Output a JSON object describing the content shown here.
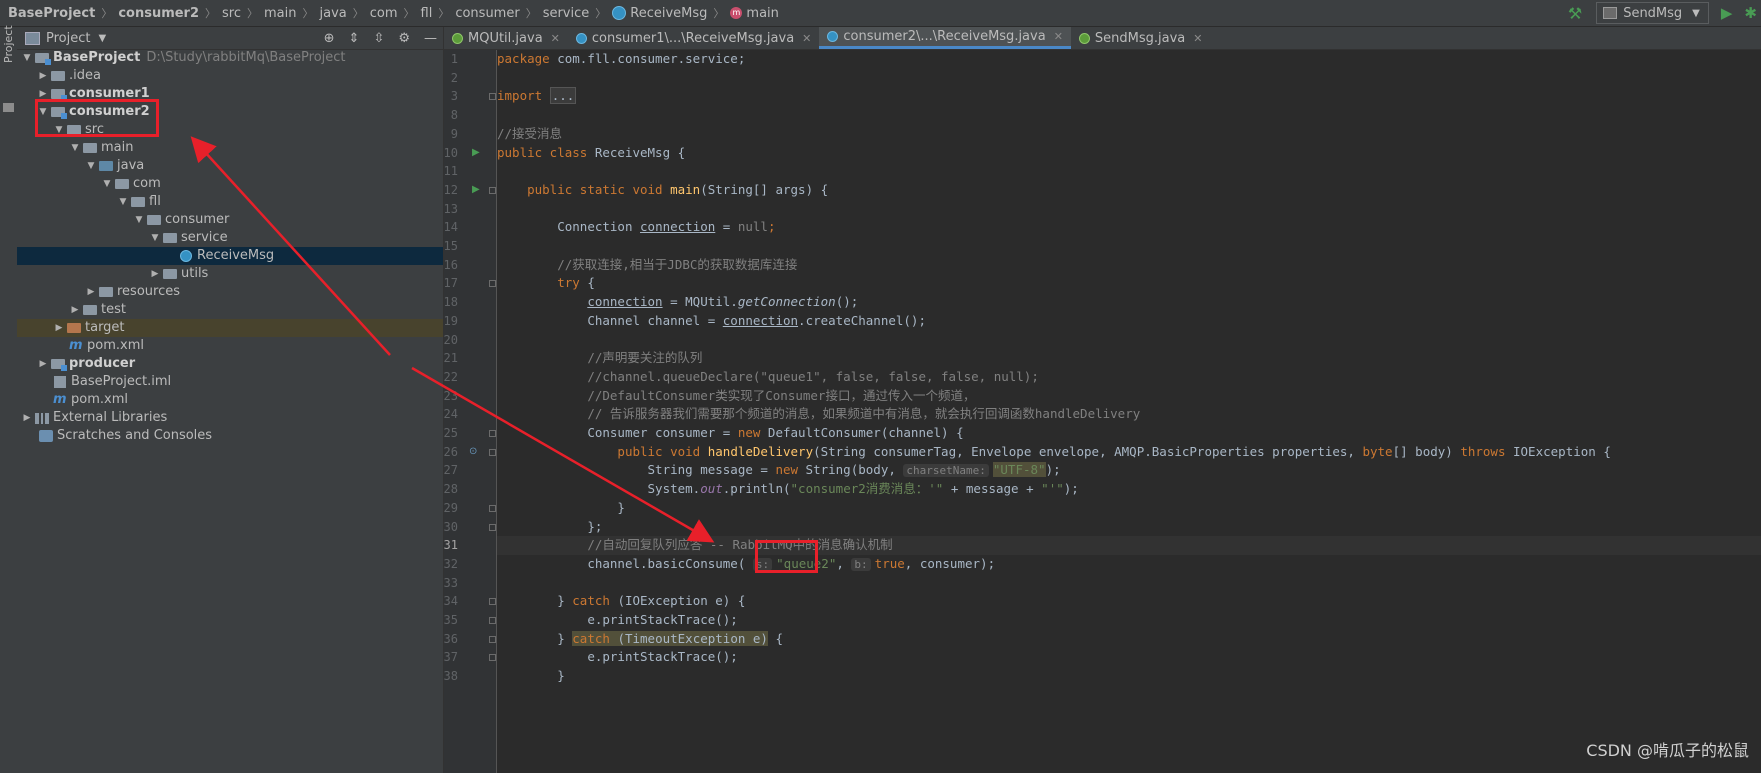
{
  "breadcrumb": {
    "items": [
      "BaseProject",
      "consumer2",
      "src",
      "main",
      "java",
      "com",
      "fll",
      "consumer",
      "service",
      "ReceiveMsg",
      "main"
    ]
  },
  "toolbar": {
    "run_config": "SendMsg"
  },
  "side_tool": {
    "project_label": "Project"
  },
  "project_panel": {
    "title": "Project",
    "tree": [
      {
        "label": "BaseProject",
        "path": "D:\\Study\\rabbitMq\\BaseProject"
      },
      {
        "label": ".idea"
      },
      {
        "label": "consumer1"
      },
      {
        "label": "consumer2"
      },
      {
        "label": "src"
      },
      {
        "label": "main"
      },
      {
        "label": "java"
      },
      {
        "label": "com"
      },
      {
        "label": "fll"
      },
      {
        "label": "consumer"
      },
      {
        "label": "service"
      },
      {
        "label": "ReceiveMsg"
      },
      {
        "label": "utils"
      },
      {
        "label": "resources"
      },
      {
        "label": "test"
      },
      {
        "label": "target"
      },
      {
        "label": "pom.xml"
      },
      {
        "label": "producer"
      },
      {
        "label": "BaseProject.iml"
      },
      {
        "label": "pom.xml"
      },
      {
        "label": "External Libraries"
      },
      {
        "label": "Scratches and Consoles"
      }
    ]
  },
  "tabs": [
    {
      "label": "MQUtil.java"
    },
    {
      "label": "consumer1\\...\\ReceiveMsg.java"
    },
    {
      "label": "consumer2\\...\\ReceiveMsg.java"
    },
    {
      "label": "SendMsg.java"
    }
  ],
  "editor": {
    "line_numbers": [
      "1",
      "2",
      "3",
      "8",
      "9",
      "10",
      "11",
      "12",
      "13",
      "14",
      "15",
      "16",
      "17",
      "18",
      "19",
      "20",
      "21",
      "22",
      "23",
      "24",
      "25",
      "26",
      "27",
      "28",
      "29",
      "30",
      "31",
      "32",
      "33",
      "34",
      "35",
      "36",
      "37",
      "38"
    ],
    "code": {
      "pkg_kw": "package",
      "pkg_name": " com.fll.consumer.service;",
      "import_kw": "import",
      "import_fold": "...",
      "c1": "//接受消息",
      "l10_kw": "public class",
      "l10_rest": " ReceiveMsg {",
      "l12_kw": "public static void",
      "l12_fn": "main",
      "l12_rest": "(String[] args) {",
      "l14_a": "Connection ",
      "l14_var": "connection",
      "l14_b": " = ",
      "l14_null": "null",
      "l14_c": ";",
      "c16": "//获取连接,相当于JDBC的获取数据库连接",
      "l17_kw": "try",
      "l17_rest": " {",
      "l18_var": "connection",
      "l18_b": " = MQUtil.",
      "l18_fn": "getConnection",
      "l18_c": "();",
      "l19_a": "Channel channel = ",
      "l19_var": "connection",
      "l19_b": ".createChannel();",
      "c21": "//声明要关注的队列",
      "c22": "//channel.queueDeclare(\"queue1\", false, false, false, null);",
      "c23": "//DefaultConsumer类实现了Consumer接口，通过传入一个频道，",
      "c24": "// 告诉服务器我们需要那个频道的消息，如果频道中有消息，就会执行回调函数handleDelivery",
      "l25_a": "Consumer consumer = ",
      "l25_kw": "new",
      "l25_b": " DefaultConsumer(channel) {",
      "l26_kw": "public void",
      "l26_fn": "handleDelivery",
      "l26_a": "(String consumerTag, Envelope envelope, AMQP.BasicProperties properties, ",
      "l26_byte": "byte",
      "l26_b": "[] body) ",
      "l26_throws": "throws",
      "l26_c": " IOException {",
      "l27_a": "String message = ",
      "l27_kw": "new",
      "l27_b": " String(body, ",
      "l27_hint": "charsetName:",
      "l27_str": "\"UTF-8\"",
      "l27_c": ");",
      "l28_a": "System.",
      "l28_out": "out",
      "l28_b": ".println(",
      "l28_str1": "\"consumer2消费消息：'\"",
      "l28_c": " + message + ",
      "l28_str2": "\"'\"",
      "l28_d": ");",
      "l29": "}",
      "l30": "};",
      "c31": "//自动回复队列应答 -- RabbitMQ中的消息确认机制",
      "l32_a": "channel.basicConsume( ",
      "l32_hint1": "s:",
      "l32_str": "\"queue2\"",
      "l32_b": ", ",
      "l32_hint2": "b:",
      "l32_kw": "true",
      "l32_c": ", consumer);",
      "l34_a": "} ",
      "l34_kw": "catch",
      "l34_b": " (IOException e) {",
      "l35": "e.printStackTrace();",
      "l36_a": "} ",
      "l36_kw": "catch",
      "l36_b": " (TimeoutException e)",
      "l36_c": " {",
      "l37": "e.printStackTrace();",
      "l38": "}"
    }
  },
  "watermark": "CSDN @啃瓜子的松鼠",
  "colors": {
    "annotation_red": "#e8202a",
    "keyword": "#cc7832",
    "string": "#6a8759",
    "comment": "#808080",
    "function": "#ffc66d"
  }
}
